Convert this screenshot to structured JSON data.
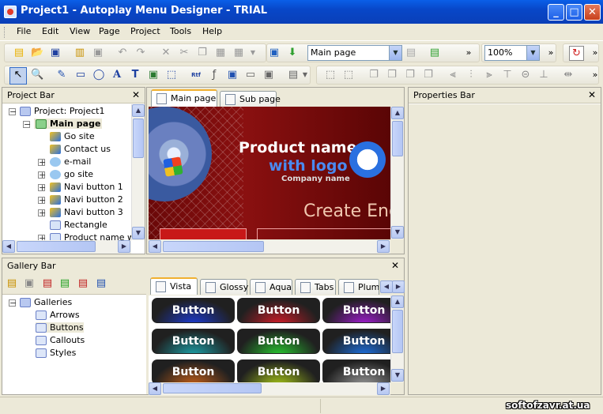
{
  "window": {
    "title": "Project1 - Autoplay Menu Designer - TRIAL"
  },
  "menu": [
    "File",
    "Edit",
    "View",
    "Page",
    "Project",
    "Tools",
    "Help"
  ],
  "toolbar": {
    "page_select": "Main page",
    "zoom": "100%"
  },
  "project_bar": {
    "title": "Project Bar",
    "items": [
      "Project: Project1",
      "Main page",
      "Go site",
      "Contact us",
      "e-mail",
      "go site",
      "Navi button 1",
      "Navi button 2",
      "Navi button 3",
      "Rectangle",
      "Product name wi"
    ]
  },
  "editor": {
    "tabs": [
      "Main page",
      "Sub page"
    ],
    "banner": {
      "product": "Product name",
      "logo": "with logo",
      "company": "Company name",
      "create": "Create Eng"
    }
  },
  "properties_bar": {
    "title": "Properties Bar"
  },
  "gallery_bar": {
    "title": "Gallery Bar",
    "tree": [
      "Galleries",
      "Arrows",
      "Buttons",
      "Callouts",
      "Styles"
    ],
    "tabs": [
      "Vista",
      "Glossy",
      "Aqua",
      "Tabs",
      "Plum"
    ],
    "button_label": "Button",
    "button_colors": [
      "#1c3ad0",
      "#d01c28",
      "#a01cd0",
      "#1ca0a8",
      "#28c830",
      "#1c70e0",
      "#c86018",
      "#a8c818",
      "#9a9a9a"
    ]
  },
  "watermark": "softofzavr.at.ua"
}
